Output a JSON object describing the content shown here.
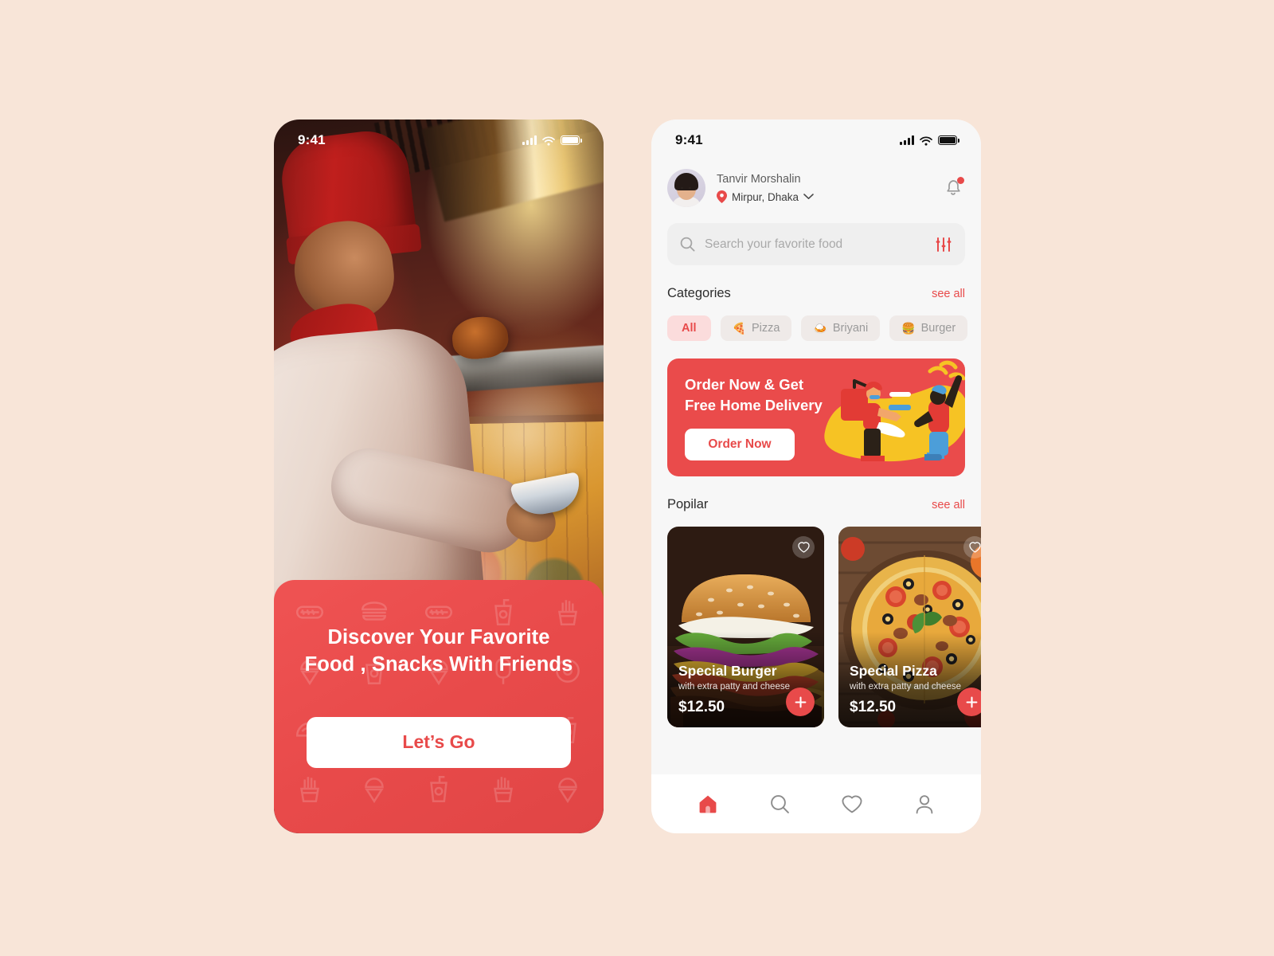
{
  "palette": {
    "page_background": "#F8E5D8",
    "accent_red": "#E84A4A",
    "chip_inactive_bg": "#EFEAE8",
    "chip_active_bg": "#FBDCDC",
    "home_background": "#F7F7F7",
    "search_bg": "#EFEFEF"
  },
  "onboarding": {
    "statusbar": {
      "time": "9:41",
      "icons": [
        "cellular-signal-icon",
        "wifi-icon",
        "battery-icon"
      ]
    },
    "hero_image_alt": "chef tossing food in restaurant kitchen",
    "card": {
      "headline_line1": "Discover Your Favorite",
      "headline_line2": "Food , Snacks With Friends",
      "cta_label": "Let’s Go",
      "pattern_icons": [
        "hotdog-icon",
        "burger-icon",
        "hotdog-icon",
        "drink-cup-icon",
        "fries-icon",
        "ice-cream-cone-icon",
        "drink-cup-icon",
        "ice-cream-cone-icon",
        "popsicle-icon",
        "donut-icon",
        "taco-icon",
        "popsicle-icon",
        "burger-icon",
        "taco-icon",
        "drink-cup-icon",
        "fries-icon",
        "ice-cream-cone-icon",
        "drink-cup-icon",
        "fries-icon",
        "ice-cream-cone-icon"
      ]
    }
  },
  "home": {
    "statusbar": {
      "time": "9:41",
      "icons": [
        "cellular-signal-icon",
        "wifi-icon",
        "battery-icon"
      ]
    },
    "user": {
      "name": "Tanvir Morshalin",
      "location": "Mirpur, Dhaka",
      "avatar_alt": "user profile photo",
      "location_icon": "map-pin-icon",
      "chevron_icon": "chevron-down-icon"
    },
    "notification": {
      "icon": "bell-icon",
      "has_badge": true
    },
    "search": {
      "placeholder": "Search your favorite food",
      "value": "",
      "search_icon": "search-icon",
      "filter_icon": "filter-sliders-icon"
    },
    "categories": {
      "title": "Categories",
      "see_all": "see all",
      "items": [
        {
          "label": "All",
          "emoji": "",
          "active": true
        },
        {
          "label": "Pizza",
          "emoji": "🍕",
          "active": false
        },
        {
          "label": "Briyani",
          "emoji": "🍛",
          "active": false
        },
        {
          "label": "Burger",
          "emoji": "🍔",
          "active": false
        }
      ]
    },
    "promo": {
      "title_line1": "Order Now & Get",
      "title_line2": "Free Home Delivery",
      "button_label": "Order Now",
      "illustration_alt": "delivery couriers with food"
    },
    "popular": {
      "title": "Popilar",
      "see_all": "see all",
      "items": [
        {
          "name": "Special Burger",
          "description": "with extra patty and cheese",
          "price": "$12.50",
          "image_alt": "cheeseburger with lettuce tomato and fries",
          "fav_icon": "heart-icon",
          "add_icon": "plus-icon"
        },
        {
          "name": "Special Pizza",
          "description": "with extra patty and cheese",
          "price": "$12.50",
          "image_alt": "pepperoni pizza with olives and tomato",
          "fav_icon": "heart-icon",
          "add_icon": "plus-icon"
        }
      ]
    },
    "tabbar": [
      {
        "name": "home",
        "icon": "home-icon",
        "active": true
      },
      {
        "name": "search",
        "icon": "search-icon",
        "active": false
      },
      {
        "name": "favorites",
        "icon": "heart-icon",
        "active": false
      },
      {
        "name": "profile",
        "icon": "person-icon",
        "active": false
      }
    ]
  }
}
